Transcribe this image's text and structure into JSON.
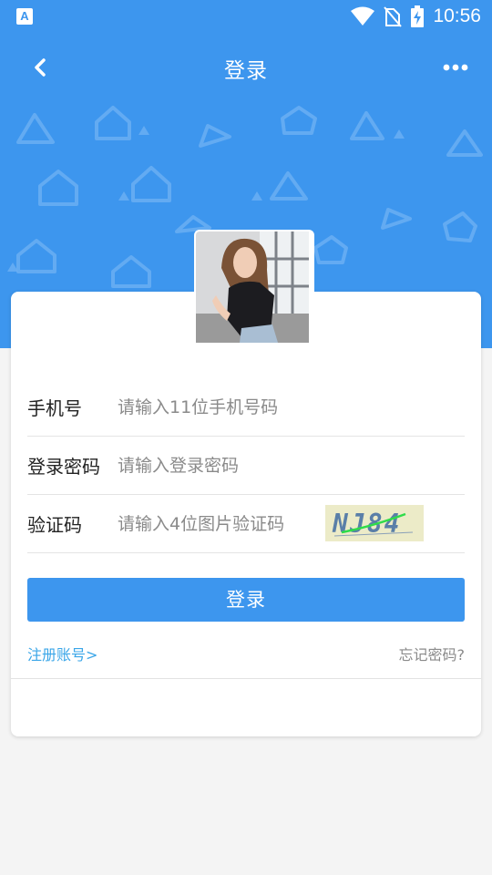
{
  "status_bar": {
    "app_badge": "A",
    "time": "10:56"
  },
  "header": {
    "title": "登录"
  },
  "form": {
    "phone": {
      "label": "手机号",
      "placeholder": "请输入11位手机号码"
    },
    "password": {
      "label": "登录密码",
      "placeholder": "请输入登录密码"
    },
    "captcha": {
      "label": "验证码",
      "placeholder": "请输入4位图片验证码",
      "image_text": "NJ84"
    }
  },
  "login_button": "登录",
  "links": {
    "register": "注册账号>",
    "forgot": "忘记密码?"
  },
  "colors": {
    "primary": "#3d96ee",
    "link": "#3aa6e8",
    "background": "#f4f4f4"
  }
}
